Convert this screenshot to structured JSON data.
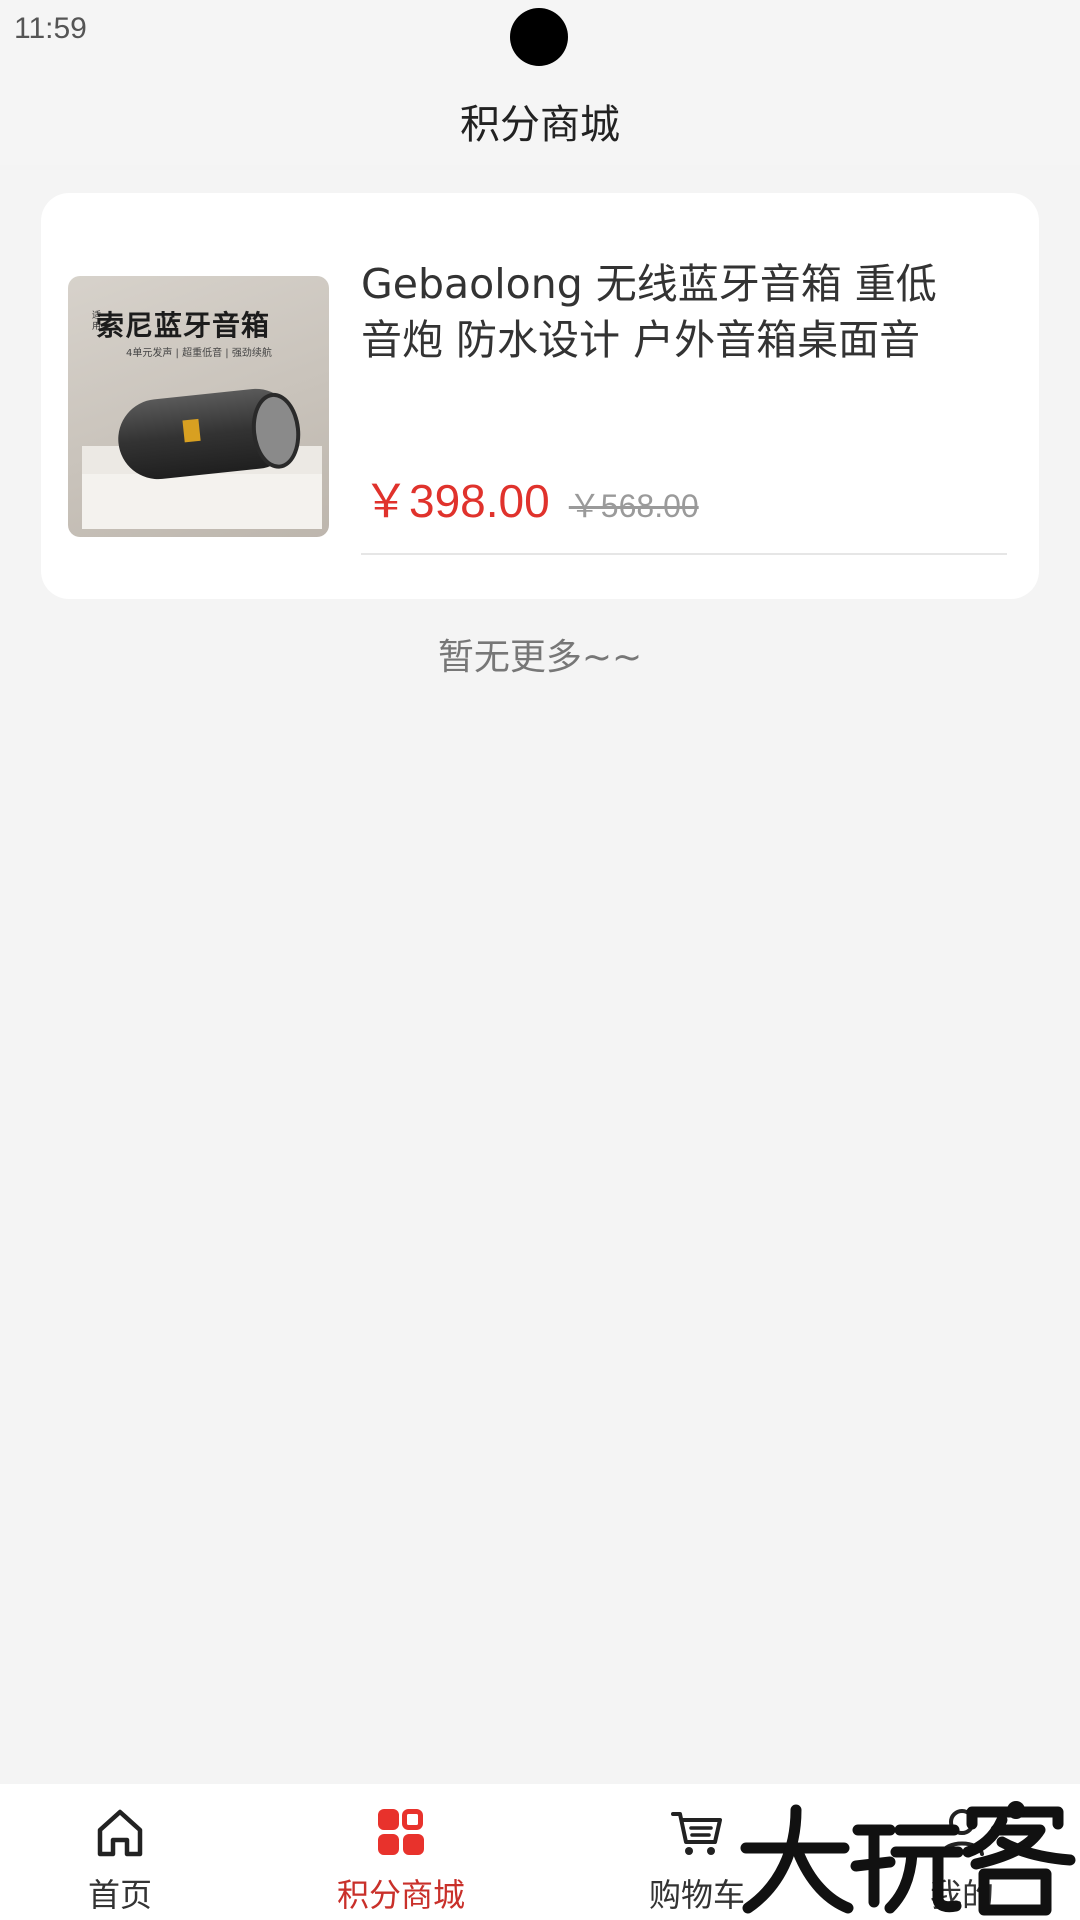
{
  "status_bar": {
    "time": "11:59"
  },
  "header": {
    "title": "积分商城"
  },
  "product": {
    "image_caption_title": "索尼蓝牙音箱",
    "image_caption_small": "适用",
    "image_caption_sub": "4单元发声 | 超重低音 | 强劲续航",
    "title": "Gebaolong 无线蓝牙音箱 重低音炮 防水设计 户外音箱桌面音",
    "price": "￥398.00",
    "original_price": "￥568.00"
  },
  "list_footer": {
    "no_more_text": "暂无更多~~"
  },
  "tab_bar": {
    "active_color": "#c9302a",
    "items": [
      {
        "label": "首页",
        "icon": "home-icon"
      },
      {
        "label": "积分商城",
        "icon": "grid-apps-icon"
      },
      {
        "label": "购物车",
        "icon": "cart-icon"
      },
      {
        "label": "我的",
        "icon": "user-icon"
      }
    ]
  },
  "watermark": {
    "text": "大玩客"
  }
}
